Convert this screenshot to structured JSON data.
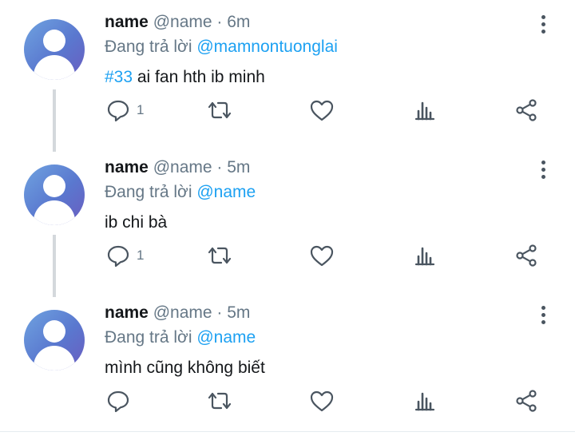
{
  "tweets": [
    {
      "name": "name",
      "handle": "@name",
      "time": "· 6m",
      "reply_prefix": "Đang trả lời",
      "reply_to": "@mamnontuonglai",
      "hashtag": "#33",
      "text": " ai fan hth ib minh",
      "reply_count": "1"
    },
    {
      "name": "name",
      "handle": "@name",
      "time": "· 5m",
      "reply_prefix": "Đang trả lời",
      "reply_to": "@name",
      "hashtag": "",
      "text": "ib chi bà",
      "reply_count": "1"
    },
    {
      "name": "name",
      "handle": "@name",
      "time": "· 5m",
      "reply_prefix": "Đang trả lời",
      "reply_to": "@name",
      "hashtag": "",
      "text": "mình cũng không biết",
      "reply_count": ""
    }
  ],
  "colors": {
    "link": "#1da1f2",
    "muted": "#657786",
    "icon": "#4a5560"
  },
  "icons": [
    "reply-icon",
    "retweet-icon",
    "like-icon",
    "stats-icon",
    "share-icon",
    "more-icon"
  ]
}
